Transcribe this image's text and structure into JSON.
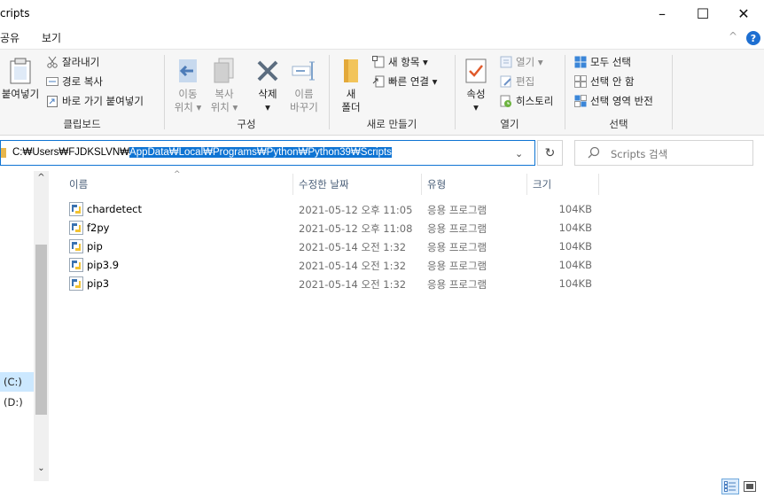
{
  "window": {
    "title": "cripts",
    "minimize": "–",
    "maximize": "☐",
    "close": "✕"
  },
  "ribbon_tabs": {
    "share": "공유",
    "view": "보기",
    "collapse": "^",
    "help": "?"
  },
  "ribbon": {
    "clipboard": {
      "label": "클립보드",
      "paste": "붙여넣기",
      "cut": "잘라내기",
      "copy_path": "경로 복사",
      "paste_shortcut": "바로 가기 붙여넣기"
    },
    "organize": {
      "label": "구성",
      "move_to_1": "이동",
      "move_to_2": "위치 ▾",
      "copy_to_1": "복사",
      "copy_to_2": "위치 ▾",
      "delete_1": "삭제",
      "delete_2": "▾",
      "rename_1": "이름",
      "rename_2": "바꾸기"
    },
    "new": {
      "label": "새로 만들기",
      "new_folder_1": "새",
      "new_folder_2": "폴더",
      "new_item": "새 항목 ▾",
      "easy_access": "빠른 연결 ▾"
    },
    "open": {
      "label": "열기",
      "properties_1": "속성",
      "properties_2": "▾",
      "open": "열기 ▾",
      "edit": "편집",
      "history": "히스토리"
    },
    "select": {
      "label": "선택",
      "select_all": "모두 선택",
      "select_none": "선택 안 함",
      "invert": "선택 영역 반전"
    }
  },
  "address": {
    "prefix": "C:₩Users₩FJDKSLVN₩",
    "selected": "AppData₩Local₩Programs₩Python₩Python39₩Scripts",
    "dropdown": "⌄",
    "refresh": "↻"
  },
  "search": {
    "placeholder": "Scripts 검색"
  },
  "nav": {
    "scroll_up": "^",
    "scroll_down": "⌄",
    "drive_c": "(C:)",
    "drive_d": "(D:)"
  },
  "columns": {
    "name": "이름",
    "modified": "수정한 날짜",
    "type": "유형",
    "size": "크기",
    "sort_indicator": "^"
  },
  "files": [
    {
      "name": "chardetect",
      "modified": "2021-05-12 오후 11:05",
      "type": "응용 프로그램",
      "size": "104KB"
    },
    {
      "name": "f2py",
      "modified": "2021-05-12 오후 11:08",
      "type": "응용 프로그램",
      "size": "104KB"
    },
    {
      "name": "pip",
      "modified": "2021-05-14 오전 1:32",
      "type": "응용 프로그램",
      "size": "104KB"
    },
    {
      "name": "pip3.9",
      "modified": "2021-05-14 오전 1:32",
      "type": "응용 프로그램",
      "size": "104KB"
    },
    {
      "name": "pip3",
      "modified": "2021-05-14 오전 1:32",
      "type": "응용 프로그램",
      "size": "104KB"
    }
  ],
  "colors": {
    "accent": "#0f74d3",
    "nav_selected": "#cce8ff",
    "folder": "#e8b64c"
  }
}
